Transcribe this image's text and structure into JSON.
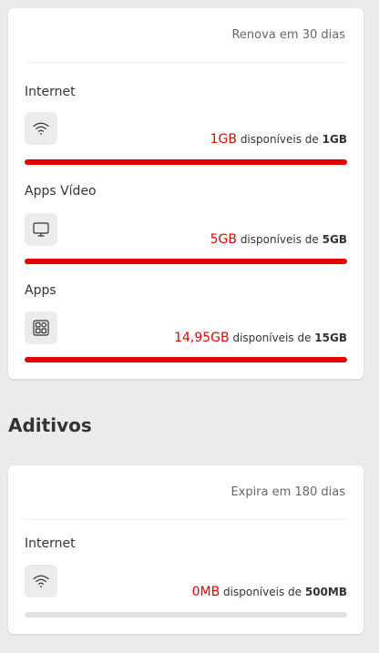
{
  "plans": {
    "renew_text": "Renova em 30 dias",
    "items": [
      {
        "title": "Internet",
        "icon": "wifi-icon",
        "available": "1GB",
        "mid_text": "disponíveis de",
        "total": "1GB",
        "fill_fraction": 1.0
      },
      {
        "title": "Apps Vídeo",
        "icon": "monitor-icon",
        "available": "5GB",
        "mid_text": "disponíveis de",
        "total": "5GB",
        "fill_fraction": 1.0
      },
      {
        "title": "Apps",
        "icon": "apps-grid-icon",
        "available": "14,95GB",
        "mid_text": "disponíveis de",
        "total": "15GB",
        "fill_fraction": 1.0
      }
    ]
  },
  "addons": {
    "section_title": "Aditivos",
    "expire_text": "Expira em 180 dias",
    "items": [
      {
        "title": "Internet",
        "icon": "wifi-icon",
        "available": "0MB",
        "mid_text": "disponíveis de",
        "total": "500MB",
        "fill_fraction": 0.0
      }
    ]
  },
  "colors": {
    "accent": "#e60000",
    "bar_track": "#e2e2e2",
    "background": "#ebebeb"
  }
}
